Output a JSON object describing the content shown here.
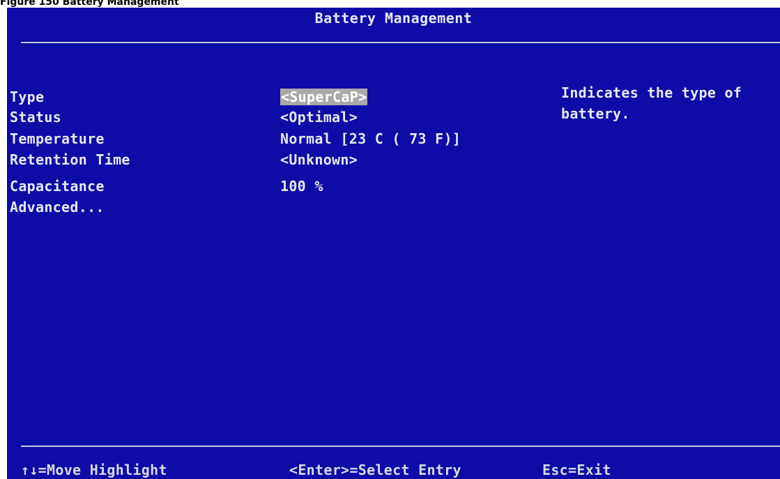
{
  "caption": "Figure 150 Battery Management",
  "title": "Battery Management",
  "rows": [
    {
      "label": "Type",
      "value": "<SuperCaP>",
      "highlighted": true
    },
    {
      "label": "Status",
      "value": "<Optimal>"
    },
    {
      "label": "Temperature",
      "value": "Normal [23 C ( 73 F)]"
    },
    {
      "label": "Retention Time",
      "value": "<Unknown>"
    },
    {
      "label": "Capacitance",
      "value": "100 %"
    },
    {
      "label": "Advanced...",
      "value": ""
    }
  ],
  "help_text": "Indicates the type of\nbattery.",
  "footer": {
    "move": "↑↓=Move Highlight",
    "select": "<Enter>=Select Entry",
    "exit": "Esc=Exit"
  },
  "colors": {
    "background": "#0d0ca6",
    "text": "#e8e8f0",
    "highlight": "#a9a9a9"
  }
}
